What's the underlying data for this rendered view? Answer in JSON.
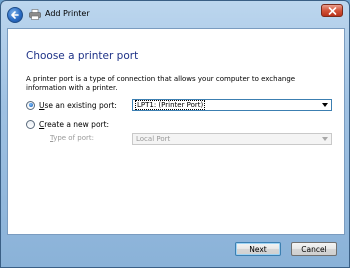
{
  "window": {
    "title": "Add Printer",
    "close_glyph": "✕",
    "back_glyph": "←"
  },
  "page": {
    "heading": "Choose a printer port",
    "description": "A printer port is a type of connection that allows your computer to exchange information with a printer."
  },
  "options": {
    "existing": {
      "label_first": "U",
      "label_rest": "se an existing port:",
      "selected": true,
      "value": "LPT1: (Printer Port)"
    },
    "new": {
      "label_first": "C",
      "label_rest": "reate a new port:",
      "selected": false,
      "type_label_first": "T",
      "type_label_rest": "ype of port:",
      "type_value": "Local Port"
    }
  },
  "buttons": {
    "next": "Next",
    "cancel": "Cancel"
  },
  "colors": {
    "heading": "#1e3287",
    "frame": "#9fc1e2"
  },
  "icons": [
    "back-arrow-icon",
    "printer-icon",
    "close-icon",
    "chevron-down-icon"
  ]
}
